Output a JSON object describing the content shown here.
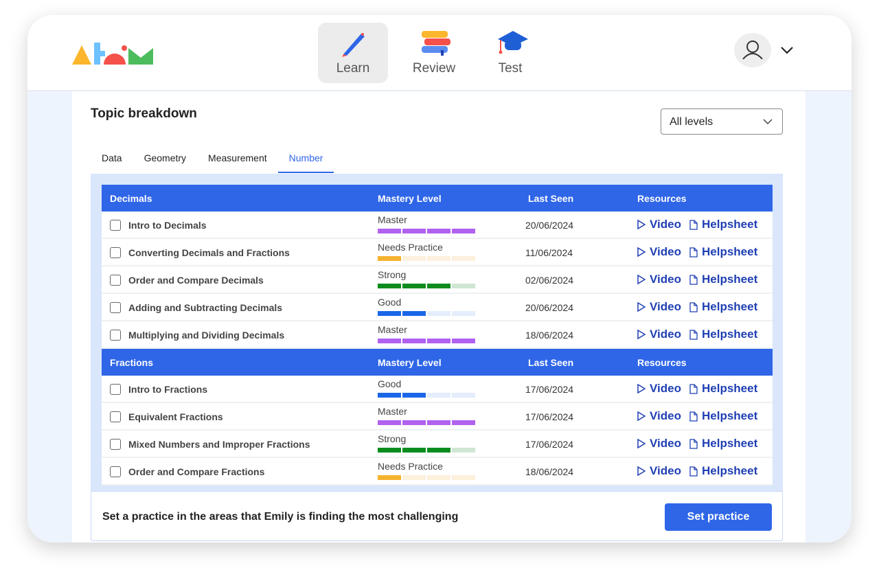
{
  "nav": {
    "items": [
      {
        "label": "Learn",
        "icon": "pencil-icon",
        "active": true
      },
      {
        "label": "Review",
        "icon": "books-icon"
      },
      {
        "label": "Test",
        "icon": "graduation-cap-icon"
      }
    ]
  },
  "page": {
    "title": "Topic breakdown",
    "level_select": "All levels"
  },
  "tabs": [
    "Data",
    "Geometry",
    "Measurement",
    "Number"
  ],
  "active_tab": "Number",
  "columns": {
    "mastery": "Mastery Level",
    "last_seen": "Last Seen",
    "resources": "Resources"
  },
  "resources": {
    "video": "Video",
    "helpsheet": "Helpsheet"
  },
  "colors": {
    "accent": "#2f66e8",
    "Master": "#b061f0",
    "Strong": "#0a8c1e",
    "Good": "#1a66e8",
    "Needs Practice": "#f5b22f"
  },
  "sections": [
    {
      "title": "Decimals",
      "rows": [
        {
          "name": "Intro to Decimals",
          "level": "Master",
          "filled": 4,
          "date": "20/06/2024"
        },
        {
          "name": "Converting Decimals and Fractions",
          "level": "Needs Practice",
          "filled": 1,
          "date": "11/06/2024"
        },
        {
          "name": "Order and Compare Decimals",
          "level": "Strong",
          "filled": 3,
          "date": "02/06/2024"
        },
        {
          "name": "Adding and Subtracting Decimals",
          "level": "Good",
          "filled": 2,
          "date": "20/06/2024"
        },
        {
          "name": "Multiplying and Dividing Decimals",
          "level": "Master",
          "filled": 4,
          "date": "18/06/2024"
        }
      ]
    },
    {
      "title": "Fractions",
      "rows": [
        {
          "name": "Intro to Fractions",
          "level": "Good",
          "filled": 2,
          "date": "17/06/2024"
        },
        {
          "name": "Equivalent Fractions",
          "level": "Master",
          "filled": 4,
          "date": "17/06/2024"
        },
        {
          "name": "Mixed Numbers and Improper Fractions",
          "level": "Strong",
          "filled": 3,
          "date": "17/06/2024"
        },
        {
          "name": "Order and Compare Fractions",
          "level": "Needs Practice",
          "filled": 1,
          "date": "18/06/2024"
        }
      ]
    }
  ],
  "footer": {
    "text": "Set a practice in the areas that Emily is finding the most challenging",
    "button": "Set practice"
  }
}
